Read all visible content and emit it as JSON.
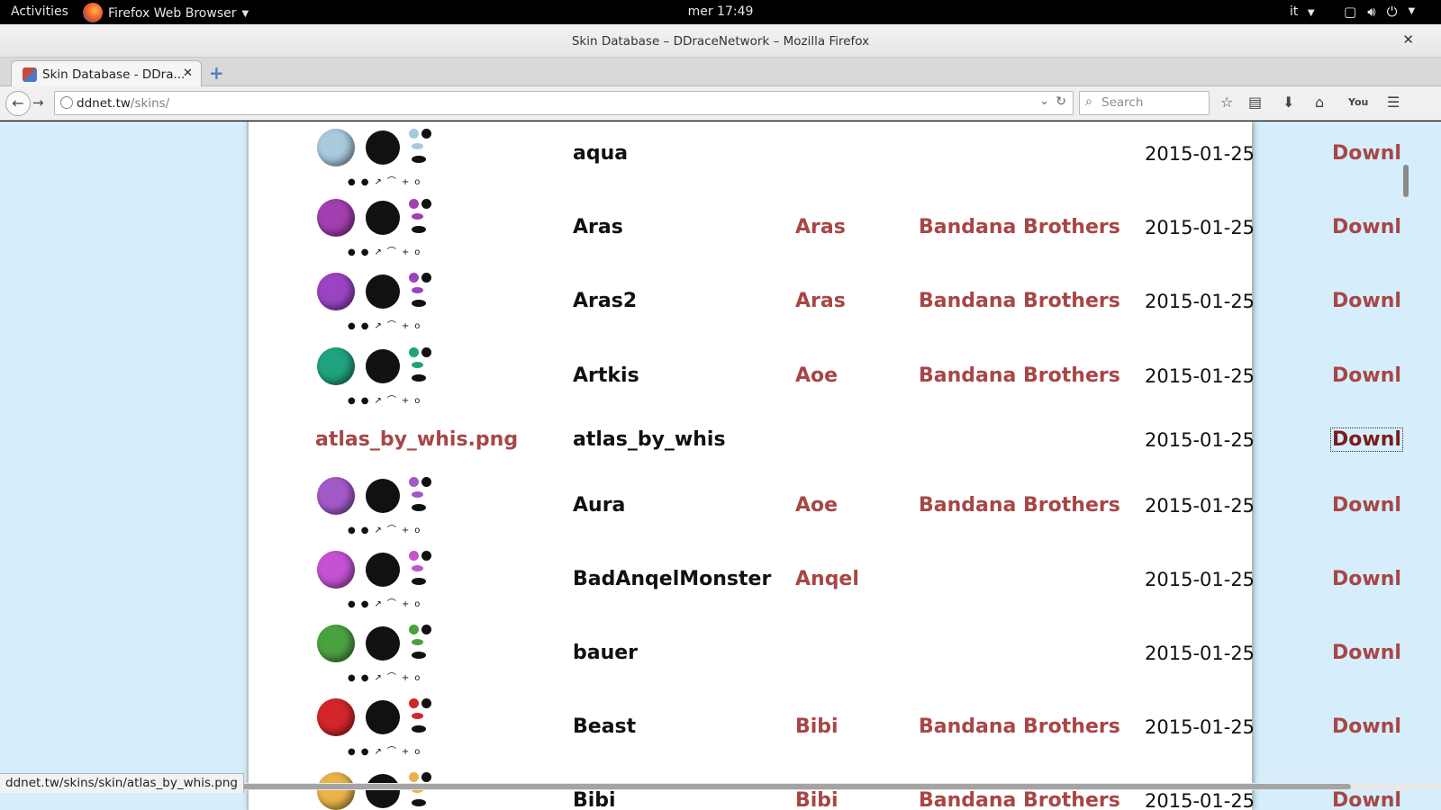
{
  "topbar": {
    "activities": "Activities",
    "app_menu": "Firefox Web Browser",
    "clock": "mer 17:49",
    "lang": "it"
  },
  "window": {
    "title": "Skin Database – DDraceNetwork – Mozilla Firefox"
  },
  "tabs": [
    {
      "label": "Skin Database - DDra..."
    }
  ],
  "navbar": {
    "url_host": "ddnet.tw",
    "url_path": "/skins/",
    "search_placeholder": "Search",
    "toolbar_icons": [
      "star-icon",
      "reading-list-icon",
      "download-icon",
      "home-icon",
      "youtube-icon",
      "menu-icon"
    ]
  },
  "colors": {
    "link": "#a84646",
    "page_bg": "#d6eefb",
    "content_bg": "#ffffff"
  },
  "skins": [
    {
      "preview_file": "",
      "name": "aqua",
      "author": "",
      "pack": "",
      "date": "2015-01-25",
      "download": "Downl",
      "body_color": "#a9c9dd"
    },
    {
      "preview_file": "",
      "name": "Aras",
      "author": "Aras",
      "pack": "Bandana Brothers",
      "date": "2015-01-25",
      "download": "Downl",
      "body_color": "#a23fb0"
    },
    {
      "preview_file": "",
      "name": "Aras2",
      "author": "Aras",
      "pack": "Bandana Brothers",
      "date": "2015-01-25",
      "download": "Downl",
      "body_color": "#9b44c2"
    },
    {
      "preview_file": "",
      "name": "Artkis",
      "author": "Aoe",
      "pack": "Bandana Brothers",
      "date": "2015-01-25",
      "download": "Downl",
      "body_color": "#1fa37e"
    },
    {
      "preview_file": "atlas_by_whis.png",
      "name": "atlas_by_whis",
      "author": "",
      "pack": "",
      "date": "2015-01-25",
      "download": "Downl",
      "focused": true
    },
    {
      "preview_file": "",
      "name": "Aura",
      "author": "Aoe",
      "pack": "Bandana Brothers",
      "date": "2015-01-25",
      "download": "Downl",
      "body_color": "#a35ac9"
    },
    {
      "preview_file": "",
      "name": "BadAnqelMonster",
      "author": "Anqel",
      "pack": "",
      "date": "2015-01-25",
      "download": "Downl",
      "body_color": "#c552d3"
    },
    {
      "preview_file": "",
      "name": "bauer",
      "author": "",
      "pack": "",
      "date": "2015-01-25",
      "download": "Downl",
      "body_color": "#4aa23f"
    },
    {
      "preview_file": "",
      "name": "Beast",
      "author": "Bibi",
      "pack": "Bandana Brothers",
      "date": "2015-01-25",
      "download": "Downl",
      "body_color": "#d3262a"
    },
    {
      "preview_file": "",
      "name": "Bibi",
      "author": "Bibi",
      "pack": "Bandana Brothers",
      "date": "2015-01-25",
      "download": "Downl",
      "body_color": "#e9b34a"
    }
  ],
  "status_url": "ddnet.tw/skins/skin/atlas_by_whis.png"
}
